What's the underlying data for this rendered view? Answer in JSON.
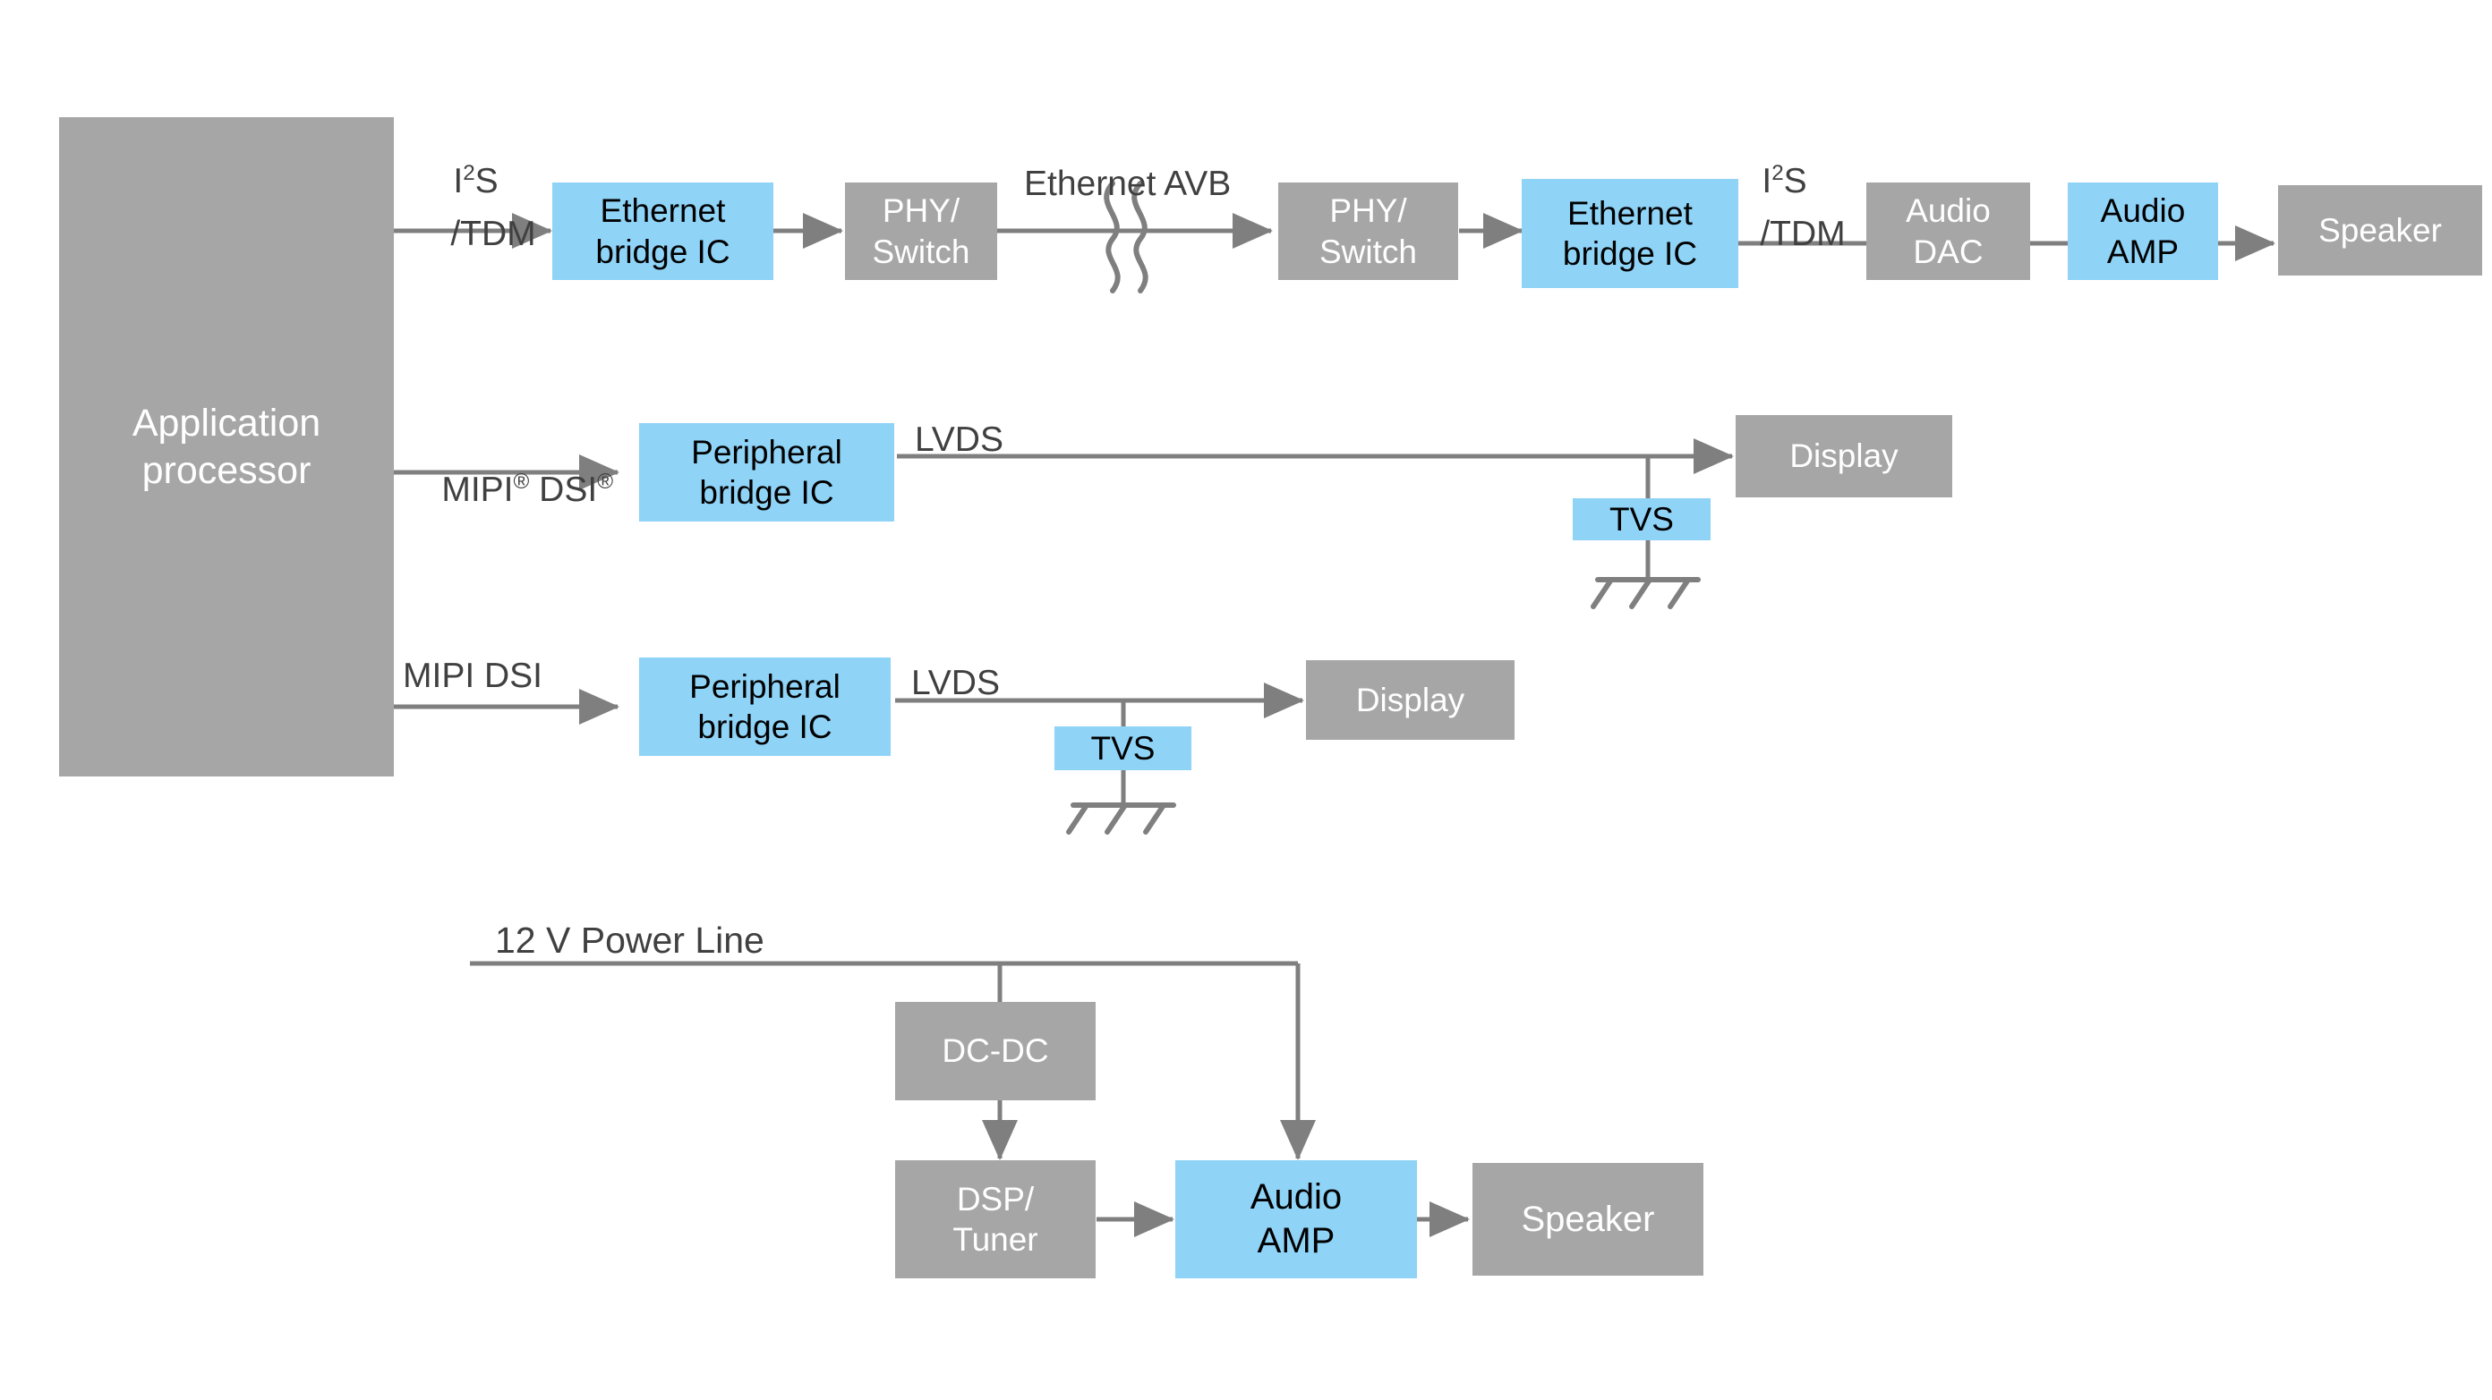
{
  "diagram": {
    "title": "Automotive infotainment audio and display block diagram",
    "colors": {
      "gray_block": "#a6a6a6",
      "blue_block": "#8fd3f7",
      "line": "#7f7f7f",
      "text_on_gray": "#ffffff",
      "text_on_blue": "#000000",
      "label_text": "#404040",
      "background": "#ffffff"
    },
    "blocks": [
      {
        "id": "application-processor",
        "label": "Application\nprocessor",
        "style": "gray"
      },
      {
        "id": "ethernet-bridge-ic-1",
        "label": "Ethernet\nbridge IC",
        "style": "blue"
      },
      {
        "id": "phy-switch-1",
        "label": "PHY/\nSwitch",
        "style": "gray"
      },
      {
        "id": "phy-switch-2",
        "label": "PHY/\nSwitch",
        "style": "gray"
      },
      {
        "id": "ethernet-bridge-ic-2",
        "label": "Ethernet\nbridge IC",
        "style": "blue"
      },
      {
        "id": "audio-dac",
        "label": "Audio\nDAC",
        "style": "gray"
      },
      {
        "id": "audio-amp-top",
        "label": "Audio\nAMP",
        "style": "blue"
      },
      {
        "id": "speaker-top",
        "label": "Speaker",
        "style": "gray"
      },
      {
        "id": "peripheral-bridge-ic-1",
        "label": "Peripheral\nbridge IC",
        "style": "blue"
      },
      {
        "id": "tvs-1",
        "label": "TVS",
        "style": "blue"
      },
      {
        "id": "display-1",
        "label": "Display",
        "style": "gray"
      },
      {
        "id": "peripheral-bridge-ic-2",
        "label": "Peripheral\nbridge IC",
        "style": "blue"
      },
      {
        "id": "tvs-2",
        "label": "TVS",
        "style": "blue"
      },
      {
        "id": "display-2",
        "label": "Display",
        "style": "gray"
      },
      {
        "id": "dc-dc",
        "label": "DC-DC",
        "style": "gray"
      },
      {
        "id": "dsp-tuner",
        "label": "DSP/\nTuner",
        "style": "gray"
      },
      {
        "id": "audio-amp-bottom",
        "label": "Audio\nAMP",
        "style": "blue"
      },
      {
        "id": "speaker-bottom",
        "label": "Speaker",
        "style": "gray"
      }
    ],
    "connection_labels": [
      {
        "id": "i2s-tdm-left-line1",
        "text": "I",
        "sup": "2",
        "tail": "S"
      },
      {
        "id": "i2s-tdm-left-line2",
        "text": "/TDM"
      },
      {
        "id": "ethernet-avb",
        "text": "Ethernet AVB"
      },
      {
        "id": "i2s-tdm-right-line1",
        "text": "I",
        "sup": "2",
        "tail": "S"
      },
      {
        "id": "i2s-tdm-right-line2",
        "text": "/TDM"
      },
      {
        "id": "mipi-dsi-registered",
        "text": "MIPI® DSI®"
      },
      {
        "id": "lvds-row2",
        "text": "LVDS"
      },
      {
        "id": "mipi-dsi-plain",
        "text": "MIPI DSI"
      },
      {
        "id": "lvds-row3",
        "text": "LVDS"
      },
      {
        "id": "power-line",
        "text": "12 V Power Line"
      }
    ],
    "labels": {
      "i2s_base": "I",
      "i2s_sup": "2",
      "i2s_tail": "S",
      "tdm": "/TDM",
      "ethernet_avb": "Ethernet AVB",
      "mipi": "MIPI",
      "reg": "®",
      "dsi": "DSI",
      "lvds": "LVDS",
      "mipi_dsi_plain": "MIPI DSI",
      "power_line": "12 V Power Line"
    }
  }
}
